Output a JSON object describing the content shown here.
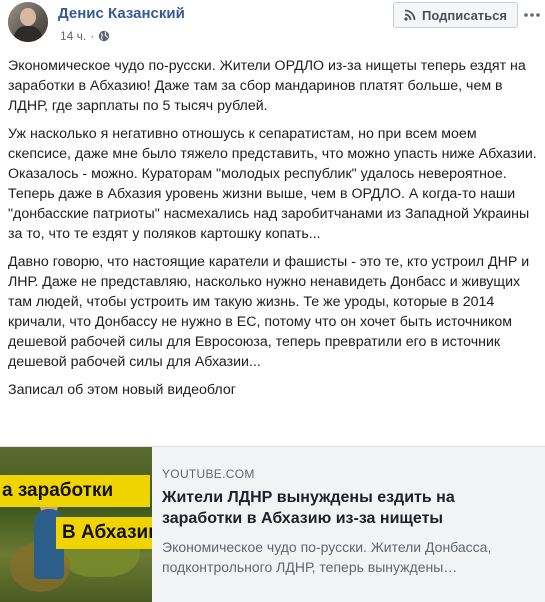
{
  "header": {
    "author_name": "Денис Казанский",
    "timestamp": "14 ч.",
    "privacy_icon": "globe-icon",
    "follow_label": "Подписаться",
    "follow_icon": "rss-icon",
    "more_icon": "more-dots-icon"
  },
  "post": {
    "paragraphs": [
      "Экономическое чудо по-русски. Жители ОРДЛО из-за нищеты теперь ездят на заработки в Абхазию! Даже там за сбор мандаринов платят больше, чем в ЛДНР, где зарплаты по 5 тысяч рублей.",
      "Уж насколько я негативно отношусь к сепаратистам, но при всем моем скепсисе, даже мне было тяжело представить, что можно упасть ниже Абхазии. Оказалось - можно. Кураторам \"молодых республик\" удалось невероятное. Теперь даже в Абхазия уровень жизни выше, чем в ОРДЛО. А когда-то наши \"донбасские патриоты\" насмехались над заробитчанами из Западной Украины за то, что те ездят у поляков картошку копать...",
      "Давно говорю, что настоящие каратели и фашисты - это те, кто устроил ДНР и ЛНР. Даже не представляю, насколько нужно ненавидеть Донбасс и живущих там людей, чтобы устроить им такую жизнь. Те же уроды, которые в 2014 кричали, что Донбассу не нужно в ЕС, потому что он хочет быть источником дешевой рабочей силы для Евросоюза, теперь превратили его в источник дешевой рабочей силы для Абхазии...",
      "Записал об этом новый видеоблог"
    ]
  },
  "link_card": {
    "thumbnail_text_1": "а заработки",
    "thumbnail_text_2": "В Абхазию",
    "source": "YOUTUBE.COM",
    "title": "Жители ЛДНР вынуждены ездить на заработки в Абхазию из-за нищеты",
    "description": "Экономическое чудо по-русски. Жители Донбасса, подконтрольного ЛДНР, теперь вынуждены…"
  },
  "colors": {
    "link_blue": "#385898",
    "thumbnail_banner": "#f0d400",
    "card_bg": "#f2f3f5"
  }
}
